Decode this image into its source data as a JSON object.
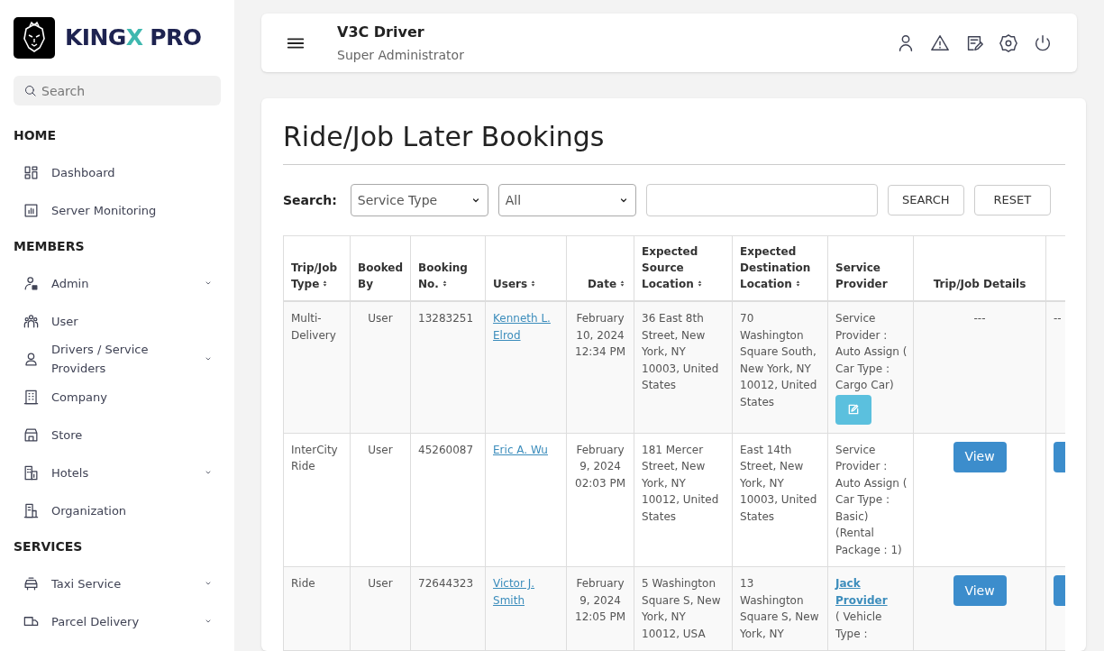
{
  "sidebar": {
    "brand": [
      {
        "text": "KING",
        "accent": false
      },
      {
        "text": "X",
        "accent": true
      },
      {
        "text": " PRO",
        "accent": false
      }
    ],
    "search": {
      "placeholder": "Search"
    },
    "sections": [
      {
        "title": "HOME",
        "items": [
          {
            "label": "Dashboard",
            "expandable": false
          },
          {
            "label": "Server Monitoring",
            "expandable": false
          }
        ]
      },
      {
        "title": "MEMBERS",
        "items": [
          {
            "label": "Admin",
            "expandable": true
          },
          {
            "label": "User",
            "expandable": false
          },
          {
            "label": "Drivers / Service Providers",
            "expandable": true
          },
          {
            "label": "Company",
            "expandable": false
          },
          {
            "label": "Store",
            "expandable": false
          },
          {
            "label": "Hotels",
            "expandable": true
          },
          {
            "label": "Organization",
            "expandable": false
          }
        ]
      },
      {
        "title": "SERVICES",
        "items": [
          {
            "label": "Taxi Service",
            "expandable": true
          },
          {
            "label": "Parcel Delivery",
            "expandable": true
          }
        ]
      }
    ]
  },
  "header": {
    "title": "V3C Driver",
    "subtitle": "Super Administrator"
  },
  "page_title": "Ride/Job Later Bookings",
  "filters": {
    "label": "Search:",
    "selects": [
      "Service Type",
      "All"
    ],
    "buttons": [
      "SEARCH",
      "RESET"
    ]
  },
  "table": {
    "columns": [
      {
        "label": "Trip/Job Type",
        "sortable": true
      },
      {
        "label": "Booked By",
        "sortable": false
      },
      {
        "label": "Booking No.",
        "sortable": true
      },
      {
        "label": "Users",
        "sortable": true
      },
      {
        "label": "Date",
        "sortable": true
      },
      {
        "label": "Expected Source Location",
        "sortable": true
      },
      {
        "label": "Expected Destination Location",
        "sortable": true
      },
      {
        "label": "Service Provider",
        "sortable": false
      },
      {
        "label": "Trip/Job Details",
        "sortable": false
      }
    ],
    "rows": [
      {
        "trip_type": "Multi-Delivery",
        "booked_by": "User",
        "booking_no": "13283251",
        "user": "Kenneth L. Elrod",
        "date": "February 10, 2024 12:34 PM",
        "source": "36 East 8th Street, New York, NY 10003, United States",
        "destination": "70 Washington Square South, New York, NY 10012, United States",
        "provider": {
          "text": "Service Provider : Auto Assign ( Car Type : Cargo Car)",
          "edit_button": true
        },
        "details": {
          "kind": "text",
          "text": "---"
        },
        "column_10": {
          "kind": "text",
          "text": "--"
        }
      },
      {
        "trip_type": "InterCity Ride",
        "booked_by": "User",
        "booking_no": "45260087",
        "user": "Eric A. Wu",
        "date": "February 9, 2024 02:03 PM",
        "source": "181 Mercer Street, New York, NY 10012, United States",
        "destination": "East 14th Street, New York, NY 10003, United States",
        "provider": {
          "text": "Service Provider : Auto Assign ( Car Type : Basic) (Rental Package : 1)",
          "edit_button": false
        },
        "details": {
          "kind": "button",
          "label": "View"
        },
        "column_10": {
          "kind": "button"
        }
      },
      {
        "trip_type": "Ride",
        "booked_by": "User",
        "booking_no": "72644323",
        "user": "Victor J. Smith",
        "date": "February 9, 2024 12:05 PM",
        "source": "5 Washington Square S, New York, NY 10012, USA",
        "destination": "13 Washington Square S, New York, NY",
        "provider": {
          "link": "Jack Provider",
          "text": "( Vehicle Type :",
          "edit_button": false
        },
        "details": {
          "kind": "button",
          "label": "View"
        },
        "column_10": {
          "kind": "button"
        }
      }
    ]
  }
}
